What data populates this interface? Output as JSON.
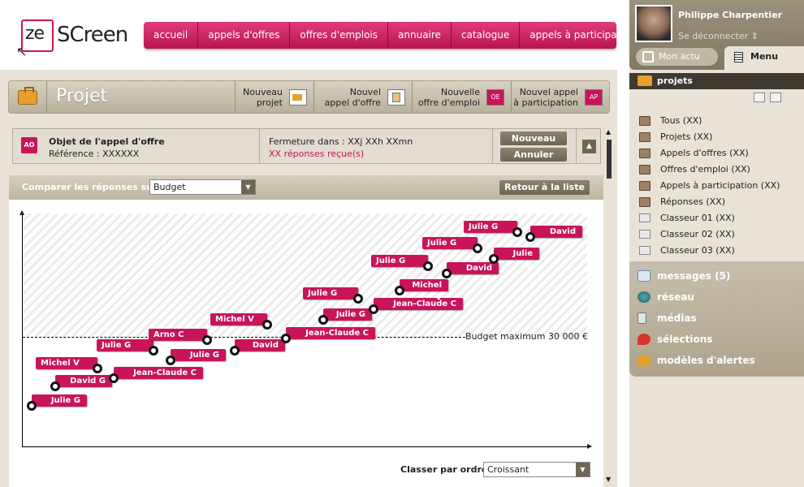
{
  "brand": {
    "logo_ze": "ze",
    "logo_screen": "SCreen"
  },
  "nav": [
    "accueil",
    "appels d'offres",
    "offres d'emplois",
    "annuaire",
    "catalogue",
    "appels à participation"
  ],
  "project": {
    "title": "Projet",
    "actions": [
      {
        "label1": "Nouveau",
        "label2": "projet",
        "icon": "new-project-icon",
        "badge": ""
      },
      {
        "label1": "Nouvel",
        "label2": "appel d'offre",
        "icon": "new-tender-icon",
        "badge": ""
      },
      {
        "label1": "Nouvelle",
        "label2": "offre d'emploi",
        "icon": "new-job-offer-icon",
        "badge": "OE"
      },
      {
        "label1": "Nouvel appel",
        "label2": "à participation",
        "icon": "new-participation-icon",
        "badge": "AP"
      }
    ]
  },
  "offer": {
    "badge": "AO",
    "object": "Objet de l'appel d'offre",
    "reference": "Référence : XXXXXX",
    "closing": "Fermeture dans : XXj XXh XXmn",
    "responses": "XX réponses reçue(s)",
    "new_label": "Nouveau",
    "cancel_label": "Annuler"
  },
  "compare": {
    "label": "Comparer les réponses sur",
    "selected": "Budget",
    "back_label": "Retour à la liste"
  },
  "chart_data": {
    "type": "scatter",
    "budget_label": "Budget maximum 30 000 €",
    "points": [
      {
        "name": "Julie G"
      },
      {
        "name": "David G"
      },
      {
        "name": "Michel V"
      },
      {
        "name": "Jean-Claude C"
      },
      {
        "name": "Julie G"
      },
      {
        "name": "Julie G"
      },
      {
        "name": "Arno C"
      },
      {
        "name": "David G"
      },
      {
        "name": "Michel V"
      },
      {
        "name": "Jean-Claude C"
      },
      {
        "name": "Julie G"
      },
      {
        "name": "Julie G"
      },
      {
        "name": "Jean-Claude C"
      },
      {
        "name": "Julie G"
      },
      {
        "name": "Michel V"
      },
      {
        "name": "David G"
      },
      {
        "name": "Julie G"
      },
      {
        "name": "Julie G"
      },
      {
        "name": "Julie G"
      },
      {
        "name": "David G"
      }
    ]
  },
  "order": {
    "label": "Classer par ordre",
    "selected": "Croissant"
  },
  "user": {
    "name": "Philippe Charpentier",
    "logout": "Se déconnecter",
    "monactu": "Mon actu",
    "menu": "Menu"
  },
  "projects": {
    "header": "projets",
    "items": [
      "Tous (XX)",
      "Projets (XX)",
      "Appels d'offres (XX)",
      "Offres d'emploi (XX)",
      "Appels à participation (XX)",
      "Réponses (XX)",
      "Classeur 01 (XX)",
      "Classeur 02 (XX)",
      "Classeur 03 (XX)"
    ]
  },
  "links": [
    "messages (5)",
    "réseau",
    "médias",
    "sélections",
    "modèles d'alertes"
  ]
}
